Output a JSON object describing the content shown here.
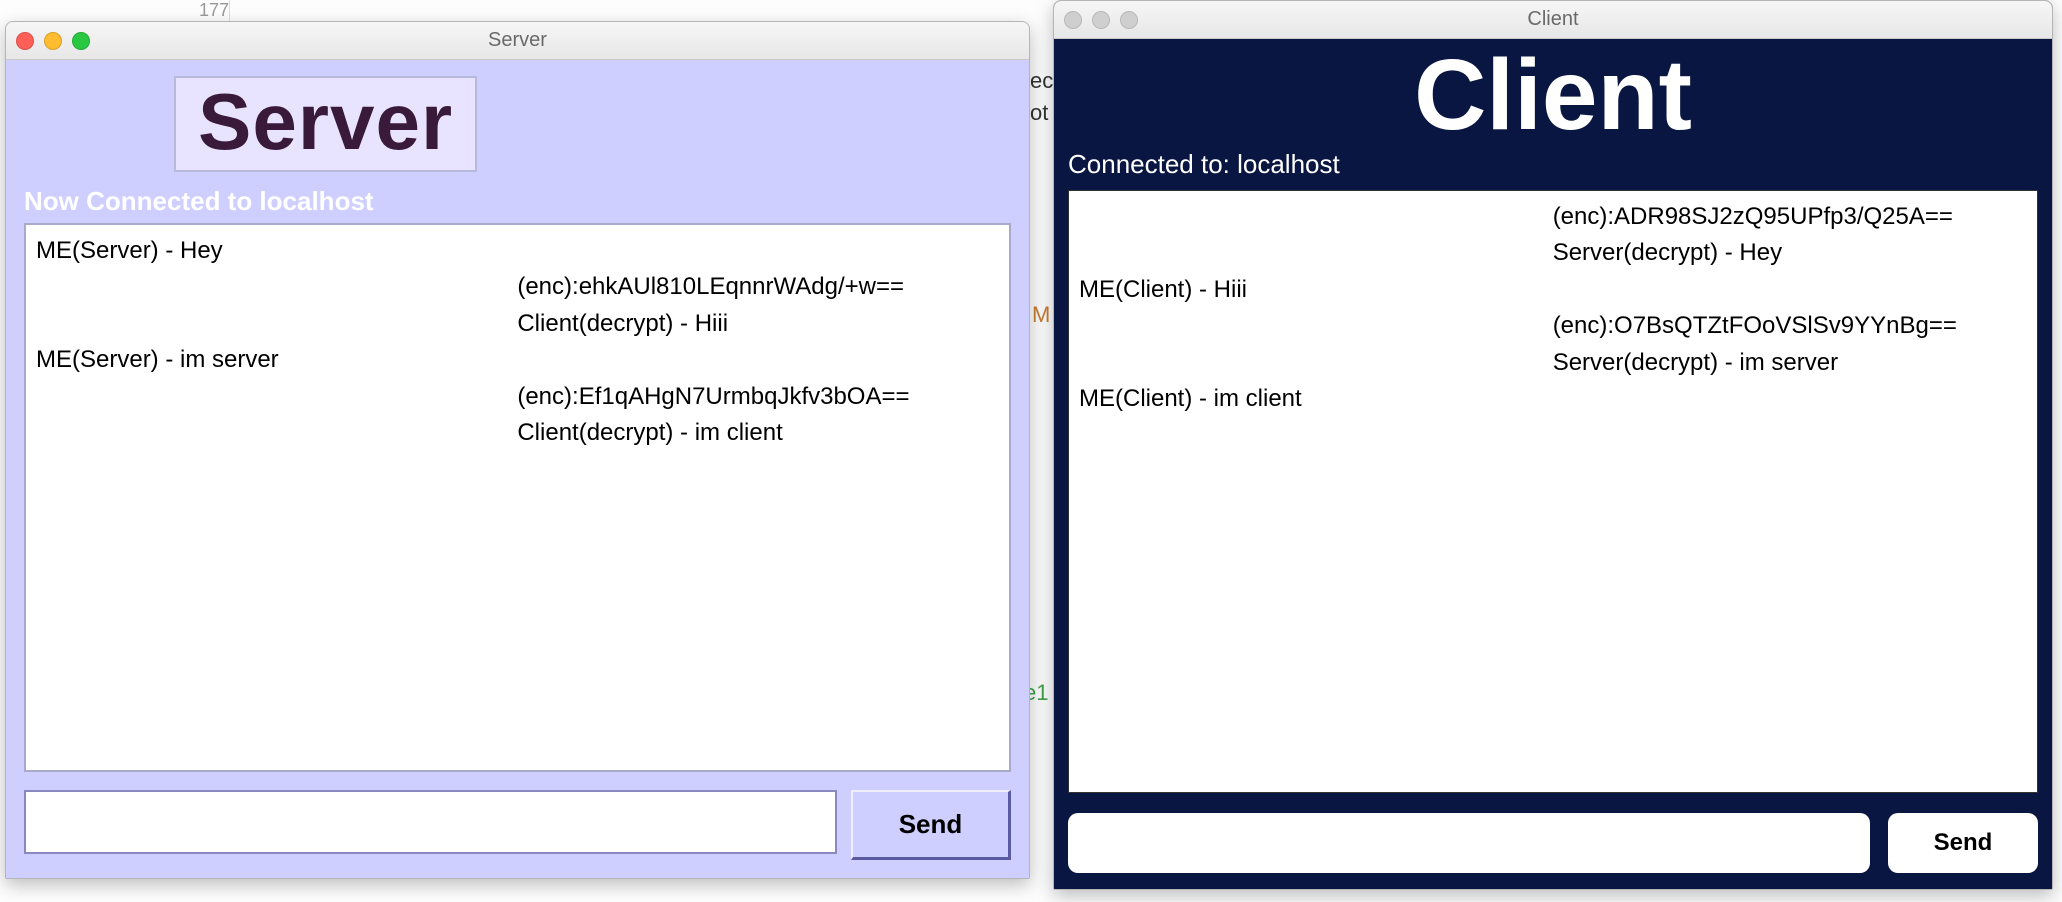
{
  "background": {
    "line_number": "177",
    "frag_ec": "ec",
    "frag_ot": "ot",
    "frag_m": "M",
    "frag_e1": "e1"
  },
  "server_window": {
    "title": "Server",
    "header_label": "Server",
    "status": "Now Connected to localhost",
    "messages_left": [
      "ME(Server) - Hey",
      "",
      "",
      "ME(Server) - im server"
    ],
    "messages_right": [
      "",
      "(enc):ehkAUl810LEqnnrWAdg/+w==",
      "Client(decrypt) - Hiii",
      "",
      "(enc):Ef1qAHgN7UrmbqJkfv3bOA==",
      "Client(decrypt) - im client"
    ],
    "input_value": "",
    "send_label": "Send"
  },
  "client_window": {
    "title": "Client",
    "header_label": "Client",
    "status": "Connected to: localhost",
    "messages_left": [
      "",
      "",
      "ME(Client) - Hiii",
      "",
      "",
      "ME(Client) - im client"
    ],
    "messages_right": [
      "(enc):ADR98SJ2zQ95UPfp3/Q25A==",
      "Server(decrypt) - Hey",
      "",
      "(enc):O7BsQTZtFOoVSlSv9YYnBg==",
      "Server(decrypt) - im server"
    ],
    "input_value": "",
    "send_label": "Send"
  }
}
